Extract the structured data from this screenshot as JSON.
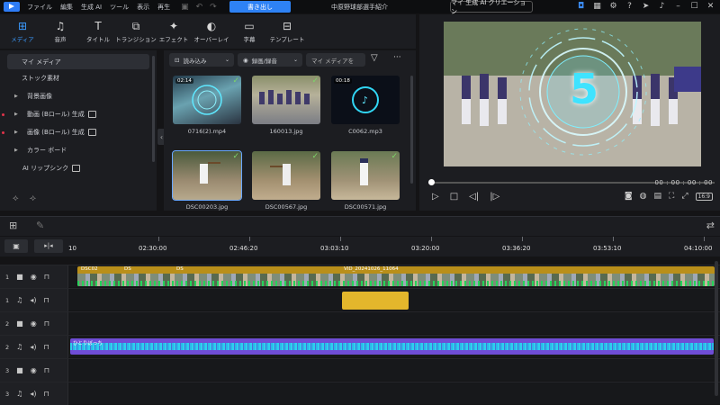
{
  "menu": {
    "items": [
      "ファイル",
      "編集",
      "生成 AI",
      "ツール",
      "表示",
      "再生"
    ]
  },
  "export_label": "書き出し",
  "project_title": "中原野球部選手紹介",
  "ai_creation_label": "マイ 生成 AI クリエーション",
  "tabs": [
    {
      "label": "メディア"
    },
    {
      "label": "音声"
    },
    {
      "label": "タイトル"
    },
    {
      "label": "トランジション"
    },
    {
      "label": "エフェクト"
    },
    {
      "label": "オーバーレイ"
    },
    {
      "label": "字幕"
    },
    {
      "label": "テンプレート"
    }
  ],
  "left_panel": {
    "items": [
      {
        "label": "マイ メディア"
      },
      {
        "label": "ストック素材"
      },
      {
        "label": "背景画像"
      },
      {
        "label": "動画 (Bロール) 生成"
      },
      {
        "label": "画像 (Bロール) 生成"
      },
      {
        "label": "カラー ボード"
      },
      {
        "label": "AI リップシンク"
      }
    ]
  },
  "media_toolbar": {
    "import_label": "読み込み",
    "record_label": "録画/録音",
    "search_placeholder": "マイ メディアを"
  },
  "media_items": [
    {
      "name": "0716(2).mp4",
      "duration": "02:14"
    },
    {
      "name": "160013.jpg"
    },
    {
      "name": "C0062.mp3",
      "duration": "00:18"
    },
    {
      "name": "DSC00203.jpg"
    },
    {
      "name": "DSC00567.jpg"
    },
    {
      "name": "DSC00571.jpg"
    }
  ],
  "preview": {
    "countdown_number": "5",
    "time": "00 : 00 : 00 : 00",
    "ratio": "16:9"
  },
  "timeline": {
    "ruler_start": "10",
    "ticks": [
      "02:30:00",
      "02:46:20",
      "03:03:10",
      "03:20:00",
      "03:36:20",
      "03:53:10",
      "04:10:00"
    ],
    "tracks": [
      {
        "num": "1",
        "type": "video"
      },
      {
        "num": "1",
        "type": "audio"
      },
      {
        "num": "2",
        "type": "video"
      },
      {
        "num": "2",
        "type": "audio"
      },
      {
        "num": "3",
        "type": "video"
      },
      {
        "num": "3",
        "type": "audio"
      }
    ],
    "clip_labels": {
      "c1": "DSC02",
      "c2": "DS",
      "c3": "DS",
      "c4": "VID_20241026_11064",
      "music": "ひとりぼっち"
    }
  }
}
